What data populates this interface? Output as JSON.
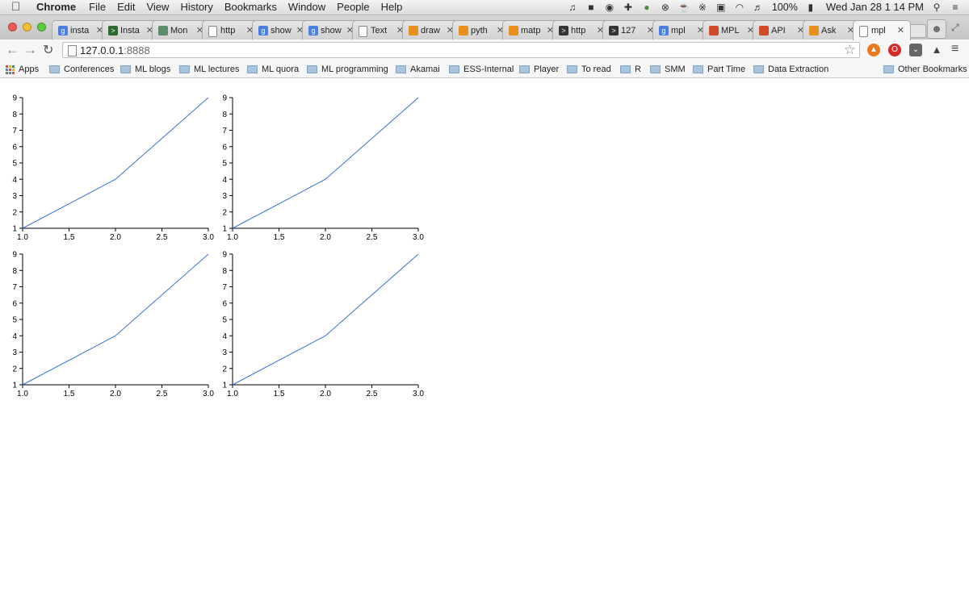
{
  "menubar": {
    "apple_icon": "apple-icon",
    "items": [
      "Chrome",
      "File",
      "Edit",
      "View",
      "History",
      "Bookmarks",
      "Window",
      "People",
      "Help"
    ],
    "battery": "100%",
    "clock": "Wed Jan 28   1 14 PM"
  },
  "tabs": [
    {
      "title": "insta",
      "favicon": "google-icon",
      "color": "#4a7fe0"
    },
    {
      "title": "Insta",
      "favicon": "terminal-icon",
      "color": "#2b6b2b"
    },
    {
      "title": "Mon",
      "favicon": "diamond-icon",
      "color": "#5c8c6a"
    },
    {
      "title": "http",
      "favicon": "page-icon",
      "color": "#ffffff"
    },
    {
      "title": "show",
      "favicon": "google-icon",
      "color": "#4a7fe0"
    },
    {
      "title": "show",
      "favicon": "google-icon",
      "color": "#4a7fe0"
    },
    {
      "title": "Text",
      "favicon": "page-icon",
      "color": "#ffffff"
    },
    {
      "title": "draw",
      "favicon": "stackoverflow-icon",
      "color": "#e8901e"
    },
    {
      "title": "pyth",
      "favicon": "stackoverflow-icon",
      "color": "#e8901e"
    },
    {
      "title": "matp",
      "favicon": "stackoverflow-icon",
      "color": "#e8901e"
    },
    {
      "title": "http",
      "favicon": "terminal-icon",
      "color": "#333333"
    },
    {
      "title": "127",
      "favicon": "terminal-icon",
      "color": "#333333"
    },
    {
      "title": "mpl",
      "favicon": "google-icon",
      "color": "#4a7fe0"
    },
    {
      "title": "MPL",
      "favicon": "bars-icon",
      "color": "#d04a2a"
    },
    {
      "title": "API",
      "favicon": "bars-icon",
      "color": "#d04a2a"
    },
    {
      "title": "Ask",
      "favicon": "stackoverflow-icon",
      "color": "#e8901e"
    },
    {
      "title": "mpl",
      "favicon": "page-icon",
      "color": "#ffffff",
      "active": true
    }
  ],
  "toolbar": {
    "url_host": "127.0.0.1",
    "url_port": ":8888"
  },
  "bookmarks": {
    "apps_label": "Apps",
    "items": [
      "Conferences",
      "ML blogs",
      "ML lectures",
      "ML quora",
      "ML programming",
      "Akamai",
      "ESS-Internal",
      "Player",
      "To read",
      "R",
      "SMM",
      "Part Time",
      "Data Extraction"
    ],
    "other": "Other Bookmarks"
  },
  "chart_data": [
    {
      "type": "line",
      "x": [
        1,
        2,
        3
      ],
      "y": [
        1,
        4,
        9
      ],
      "xlim": [
        1.0,
        3.0
      ],
      "ylim": [
        1,
        9
      ],
      "xticks": [
        "1.0",
        "1.5",
        "2.0",
        "2.5",
        "3.0"
      ],
      "yticks": [
        "1",
        "2",
        "3",
        "4",
        "5",
        "6",
        "7",
        "8",
        "9"
      ],
      "title": "",
      "xlabel": "",
      "ylabel": "",
      "grid": false,
      "color": "#3a6fd8"
    },
    {
      "type": "line",
      "x": [
        1,
        2,
        3
      ],
      "y": [
        1,
        4,
        9
      ],
      "xlim": [
        1.0,
        3.0
      ],
      "ylim": [
        1,
        9
      ],
      "xticks": [
        "1.0",
        "1.5",
        "2.0",
        "2.5",
        "3.0"
      ],
      "yticks": [
        "1",
        "2",
        "3",
        "4",
        "5",
        "6",
        "7",
        "8",
        "9"
      ],
      "title": "",
      "xlabel": "",
      "ylabel": "",
      "grid": false,
      "color": "#3a6fd8"
    },
    {
      "type": "line",
      "x": [
        1,
        2,
        3
      ],
      "y": [
        1,
        4,
        9
      ],
      "xlim": [
        1.0,
        3.0
      ],
      "ylim": [
        1,
        9
      ],
      "xticks": [
        "1.0",
        "1.5",
        "2.0",
        "2.5",
        "3.0"
      ],
      "yticks": [
        "1",
        "2",
        "3",
        "4",
        "5",
        "6",
        "7",
        "8",
        "9"
      ],
      "title": "",
      "xlabel": "",
      "ylabel": "",
      "grid": false,
      "color": "#3a6fd8"
    },
    {
      "type": "line",
      "x": [
        1,
        2,
        3
      ],
      "y": [
        1,
        4,
        9
      ],
      "xlim": [
        1.0,
        3.0
      ],
      "ylim": [
        1,
        9
      ],
      "xticks": [
        "1.0",
        "1.5",
        "2.0",
        "2.5",
        "3.0"
      ],
      "yticks": [
        "1",
        "2",
        "3",
        "4",
        "5",
        "6",
        "7",
        "8",
        "9"
      ],
      "title": "",
      "xlabel": "",
      "ylabel": "",
      "grid": false,
      "color": "#3a6fd8"
    }
  ]
}
